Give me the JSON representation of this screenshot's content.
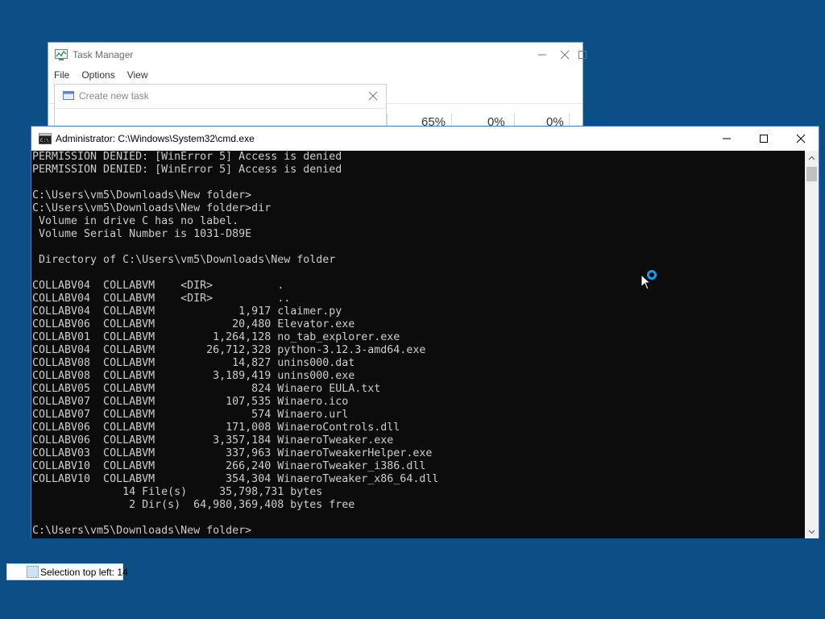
{
  "task_manager": {
    "title": "Task Manager",
    "menu": [
      "File",
      "Options",
      "View"
    ],
    "cpu_pct": "65%",
    "mem_pct": "0%",
    "disk_pct": "0%"
  },
  "create_task": {
    "title": "Create new task"
  },
  "cmd": {
    "title": "Administrator: C:\\Windows\\System32\\cmd.exe",
    "lines": [
      "PERMISSION DENIED: [WinError 5] Access is denied",
      "PERMISSION DENIED: [WinError 5] Access is denied",
      "",
      "C:\\Users\\vm5\\Downloads\\New folder>",
      "C:\\Users\\vm5\\Downloads\\New folder>dir",
      " Volume in drive C has no label.",
      " Volume Serial Number is 1031-D89E",
      "",
      " Directory of C:\\Users\\vm5\\Downloads\\New folder",
      "",
      "COLLABV04  COLLABVM    <DIR>          .",
      "COLLABV04  COLLABVM    <DIR>          ..",
      "COLLABV04  COLLABVM             1,917 claimer.py",
      "COLLABV06  COLLABVM            20,480 Elevator.exe",
      "COLLABV01  COLLABVM         1,264,128 no_tab_explorer.exe",
      "COLLABV04  COLLABVM        26,712,328 python-3.12.3-amd64.exe",
      "COLLABV08  COLLABVM            14,827 unins000.dat",
      "COLLABV08  COLLABVM         3,189,419 unins000.exe",
      "COLLABV05  COLLABVM               824 Winaero EULA.txt",
      "COLLABV07  COLLABVM           107,535 Winaero.ico",
      "COLLABV07  COLLABVM               574 Winaero.url",
      "COLLABV06  COLLABVM           171,008 WinaeroControls.dll",
      "COLLABV06  COLLABVM         3,357,184 WinaeroTweaker.exe",
      "COLLABV03  COLLABVM           337,963 WinaeroTweakerHelper.exe",
      "COLLABV10  COLLABVM           266,240 WinaeroTweaker_i386.dll",
      "COLLABV10  COLLABVM           354,304 WinaeroTweaker_x86_64.dll",
      "              14 File(s)     35,798,731 bytes",
      "               2 Dir(s)  64,980,369,408 bytes free",
      "",
      "C:\\Users\\vm5\\Downloads\\New folder>"
    ]
  },
  "selection_tooltip": {
    "text": "Selection top left: 14"
  },
  "colors": {
    "desktop": "#0b4f86",
    "console_bg": "#0c0c0c",
    "console_fg": "#cccccc",
    "busy_cursor": "#1a9bef"
  }
}
